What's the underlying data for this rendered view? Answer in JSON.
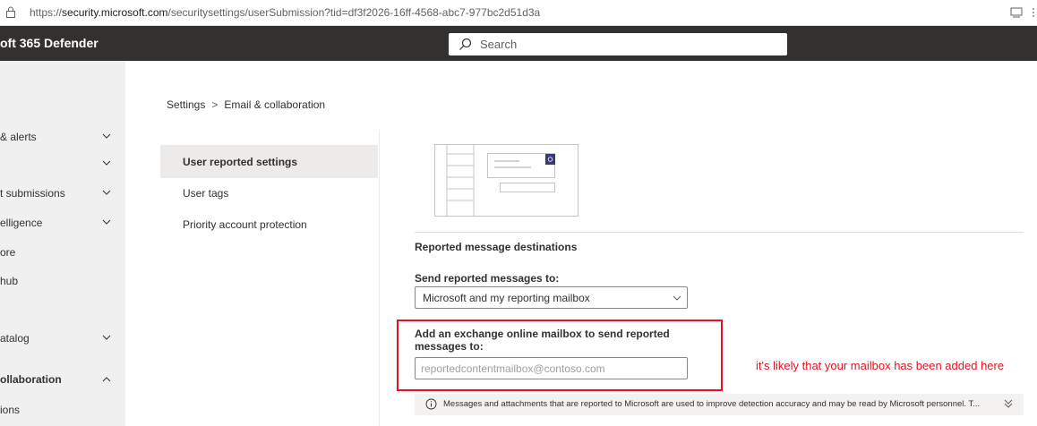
{
  "browser": {
    "url_prefix": "https://",
    "url_host": "security.microsoft.com",
    "url_path": "/securitysettings/userSubmission?tid=df3f2026-16ff-4568-abc7-977bc2d51d3a",
    "icons": {
      "lock": "lock-icon",
      "reader": "reader-view-icon",
      "more": "more-icon"
    }
  },
  "header": {
    "brand": "oft 365 Defender",
    "search_placeholder": "Search",
    "bg_color": "#323130"
  },
  "left_nav": {
    "items": [
      {
        "label": "& alerts",
        "chevron": "down",
        "bold": false
      },
      {
        "label": "",
        "chevron": "down",
        "bold": false
      },
      {
        "label": "t submissions",
        "chevron": "down",
        "bold": false
      },
      {
        "label": "elligence",
        "chevron": "down",
        "bold": false
      },
      {
        "label": "ore",
        "chevron": "",
        "bold": false
      },
      {
        "label": "hub",
        "chevron": "",
        "bold": false
      },
      {
        "label": "atalog",
        "chevron": "down",
        "bold": false
      },
      {
        "label": "ollaboration",
        "chevron": "up",
        "bold": true
      },
      {
        "label": "ions",
        "chevron": "",
        "bold": false
      }
    ]
  },
  "breadcrumb": {
    "root": "Settings",
    "separator": ">",
    "current": "Email & collaboration"
  },
  "sub_nav": {
    "items": [
      {
        "label": "User reported settings",
        "active": true
      },
      {
        "label": "User tags",
        "active": false
      },
      {
        "label": "Priority account protection",
        "active": false
      }
    ]
  },
  "main": {
    "section_title": "Reported message destinations",
    "send_label": "Send reported messages to:",
    "send_value": "Microsoft and my reporting mailbox",
    "mailbox_label": "Add an exchange online mailbox to send reported messages to:",
    "mailbox_placeholder": "reportedcontentmailbox@contoso.com",
    "info_text": "Messages and attachments that are reported to Microsoft are used to improve detection accuracy and may be read by Microsoft personnel. T...",
    "illustration_icon": "report-settings-illustration"
  },
  "annotation": {
    "text": "it's likely that your mailbox has been added here",
    "color": "#e81123"
  }
}
